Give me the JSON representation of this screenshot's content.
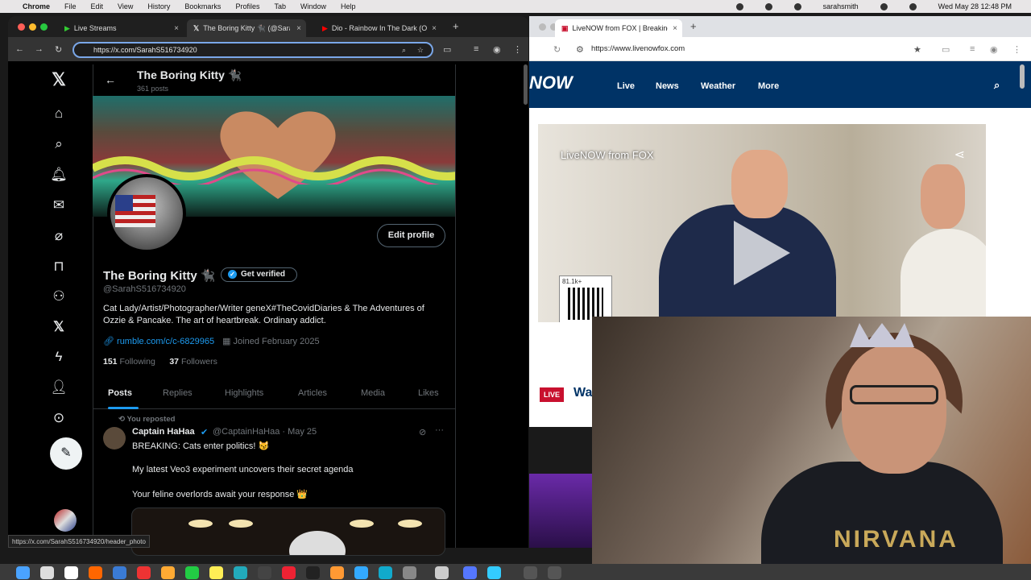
{
  "menubar": {
    "app": "Chrome",
    "items": [
      "File",
      "Edit",
      "View",
      "History",
      "Bookmarks",
      "Profiles",
      "Tab",
      "Window",
      "Help"
    ],
    "user": "sarahsmith",
    "datetime": "Wed May 28  12:48 PM"
  },
  "win1": {
    "tabs": [
      {
        "label": "Live Streams"
      },
      {
        "label": "The Boring Kitty 🐈‍⬛ (@SarahS"
      },
      {
        "label": "Dio - Rainbow In The Dark (O"
      }
    ],
    "url": "https://x.com/SarahS516734920",
    "profile": {
      "title": "The Boring Kitty 🐈‍⬛",
      "posts": "361 posts",
      "name": "The Boring Kitty 🐈‍⬛",
      "get_verified": "Get verified",
      "handle": "@SarahS516734920",
      "bio": "Cat Lady/Artist/Photographer/Writer geneX#TheCovidDiaries & The Adventures of Ozzie & Pancake. The art of heartbreak. Ordinary addict.",
      "link": "rumble.com/c/c-6829965",
      "joined": "Joined February 2025",
      "following_count": "151",
      "following_label": "Following",
      "followers_count": "37",
      "followers_label": "Followers",
      "edit": "Edit profile"
    },
    "profile_tabs": [
      "Posts",
      "Replies",
      "Highlights",
      "Articles",
      "Media",
      "Likes"
    ],
    "post": {
      "reposted": "You reposted",
      "author": "Captain HaHaa",
      "handle": "@CaptainHaHaa · May 25",
      "line1": "BREAKING: Cats enter politics! 😼",
      "line2": "My latest Veo3 experiment uncovers their secret agenda",
      "line3": "Your feline overlords await your response 👑"
    },
    "status_url": "https://x.com/SarahS516734920/header_photo"
  },
  "win2": {
    "tab": "LiveNOW from FOX | Breaking",
    "url": "https://www.livenowfox.com",
    "nav": [
      "Live",
      "News",
      "Weather",
      "More"
    ],
    "logo": "NOW",
    "video_title": "LiveNOW from FOX",
    "qr_count": "81.1k+",
    "live": "LIVE",
    "headline_start": "Wa"
  },
  "webcam": {
    "shirt_text": "NIRVANA"
  }
}
